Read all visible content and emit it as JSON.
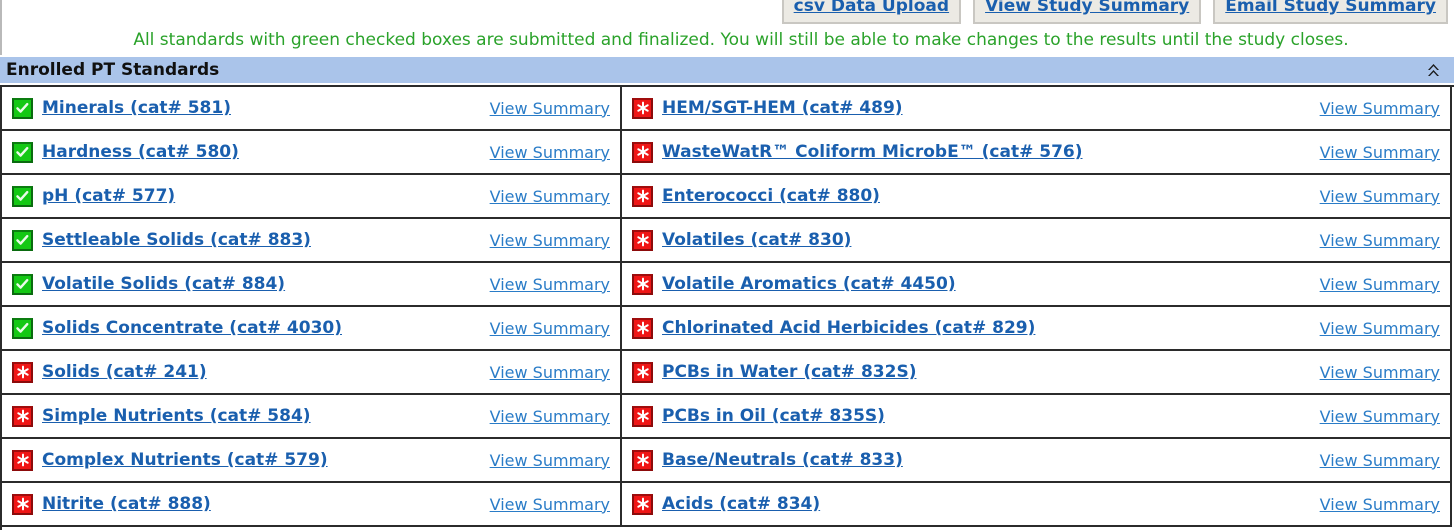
{
  "toolbar": {
    "buttons": [
      {
        "label": "csv Data Upload",
        "name": "csv-data-upload-button"
      },
      {
        "label": "View Study Summary",
        "name": "view-study-summary-button"
      },
      {
        "label": "Email Study Summary",
        "name": "email-study-summary-button"
      }
    ]
  },
  "notice": {
    "text": "All standards with green checked boxes are submitted and finalized. You will still be able to make changes to the results until the study closes.",
    "color": "#2aa22a"
  },
  "section": {
    "title": "Enrolled PT Standards",
    "header_color": "#aac4ea",
    "collapse_icon": "double-chevron-up-icon"
  },
  "link_label": "View Summary",
  "status_icons": {
    "submitted": "green-check-icon",
    "pending": "red-asterisk-icon"
  },
  "colors": {
    "link": "#1a5fae",
    "green_badge": "#14c814",
    "red_badge": "#ef1515"
  },
  "standards": {
    "left_column": [
      {
        "name": "Minerals (cat# 581)",
        "status": "submitted",
        "link": "View Summary"
      },
      {
        "name": "Hardness (cat# 580)",
        "status": "submitted",
        "link": "View Summary"
      },
      {
        "name": "pH (cat# 577)",
        "status": "submitted",
        "link": "View Summary"
      },
      {
        "name": "Settleable Solids (cat# 883)",
        "status": "submitted",
        "link": "View Summary"
      },
      {
        "name": "Volatile Solids (cat# 884)",
        "status": "submitted",
        "link": "View Summary"
      },
      {
        "name": "Solids Concentrate (cat# 4030)",
        "status": "submitted",
        "link": "View Summary"
      },
      {
        "name": "Solids (cat# 241)",
        "status": "pending",
        "link": "View Summary"
      },
      {
        "name": "Simple Nutrients (cat# 584)",
        "status": "pending",
        "link": "View Summary"
      },
      {
        "name": "Complex Nutrients (cat# 579)",
        "status": "pending",
        "link": "View Summary"
      },
      {
        "name": "Nitrite (cat# 888)",
        "status": "pending",
        "link": "View Summary"
      }
    ],
    "right_column": [
      {
        "name": "HEM/SGT-HEM (cat# 489)",
        "status": "pending",
        "link": "View Summary"
      },
      {
        "name": "WasteWatR™ Coliform MicrobE™ (cat# 576)",
        "status": "pending",
        "link": "View Summary"
      },
      {
        "name": "Enterococci (cat# 880)",
        "status": "pending",
        "link": "View Summary"
      },
      {
        "name": "Volatiles (cat# 830)",
        "status": "pending",
        "link": "View Summary"
      },
      {
        "name": "Volatile Aromatics (cat# 4450)",
        "status": "pending",
        "link": "View Summary"
      },
      {
        "name": "Chlorinated Acid Herbicides (cat# 829)",
        "status": "pending",
        "link": "View Summary"
      },
      {
        "name": "PCBs in Water (cat# 832S)",
        "status": "pending",
        "link": "View Summary"
      },
      {
        "name": "PCBs in Oil (cat# 835S)",
        "status": "pending",
        "link": "View Summary"
      },
      {
        "name": "Base/Neutrals (cat# 833)",
        "status": "pending",
        "link": "View Summary"
      },
      {
        "name": "Acids (cat# 834)",
        "status": "pending",
        "link": "View Summary"
      }
    ]
  }
}
